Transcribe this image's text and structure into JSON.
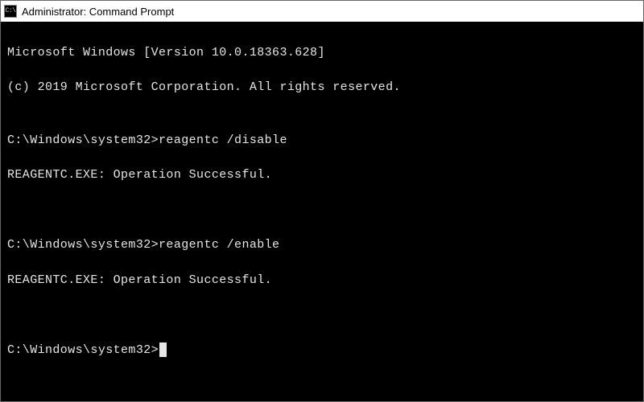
{
  "title": "Administrator: Command Prompt",
  "appicon_label": "C:\\",
  "terminal": {
    "banner_version": "Microsoft Windows [Version 10.0.18363.628]",
    "banner_copyright": "(c) 2019 Microsoft Corporation. All rights reserved.",
    "blank": "",
    "prompt": "C:\\Windows\\system32>",
    "cmd1": "reagentc /disable",
    "out1": "REAGENTC.EXE: Operation Successful.",
    "cmd2": "reagentc /enable",
    "out2": "REAGENTC.EXE: Operation Successful."
  }
}
